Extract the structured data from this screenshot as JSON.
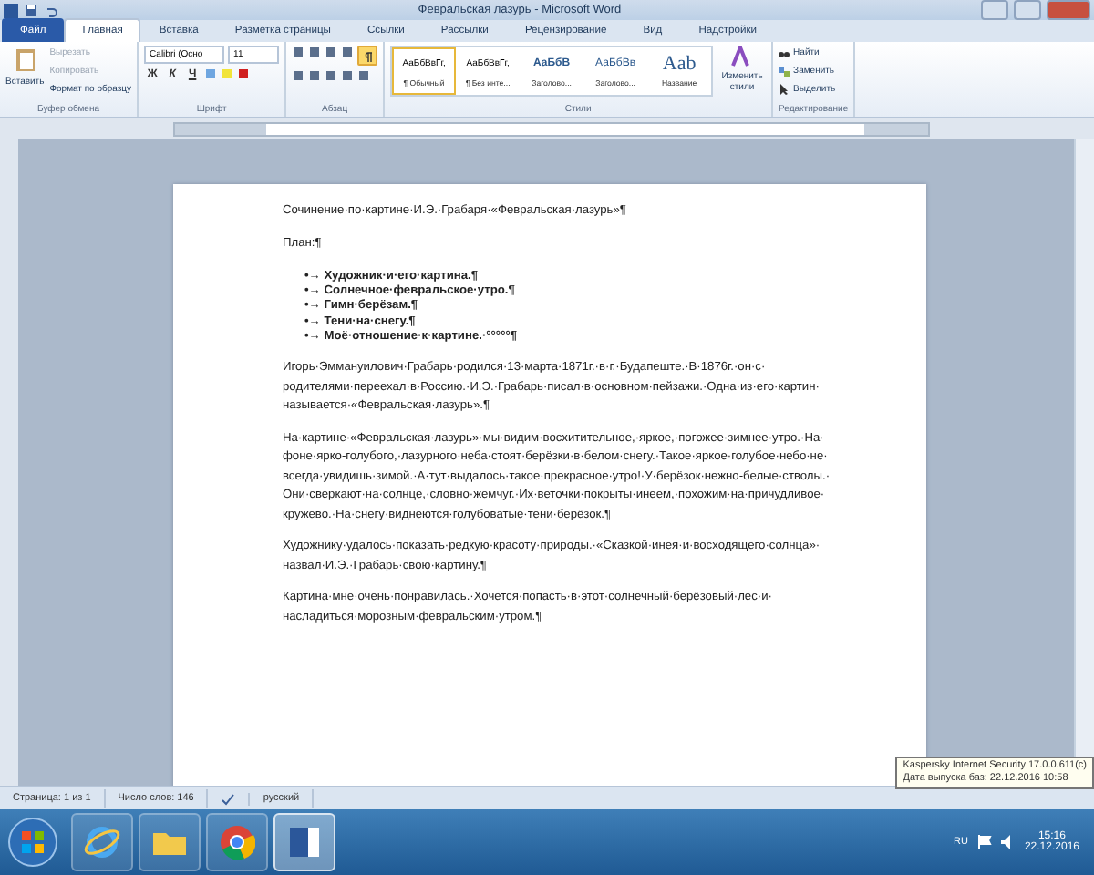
{
  "window": {
    "title": "Февральская лазурь - Microsoft Word"
  },
  "tabs": [
    {
      "label": "Файл",
      "kind": "file",
      "selected": false
    },
    {
      "label": "Главная",
      "kind": "tab",
      "selected": true
    },
    {
      "label": "Вставка",
      "kind": "tab",
      "selected": false
    },
    {
      "label": "Разметка страницы",
      "kind": "tab",
      "selected": false
    },
    {
      "label": "Ссылки",
      "kind": "tab",
      "selected": false
    },
    {
      "label": "Рассылки",
      "kind": "tab",
      "selected": false
    },
    {
      "label": "Рецензирование",
      "kind": "tab",
      "selected": false
    },
    {
      "label": "Вид",
      "kind": "tab",
      "selected": false
    },
    {
      "label": "Надстройки",
      "kind": "tab",
      "selected": false
    }
  ],
  "clipboard": {
    "group": "Буфер обмена",
    "paste": "Вставить",
    "items": [
      {
        "label": "Вырезать",
        "disabled": true
      },
      {
        "label": "Копировать",
        "disabled": true
      },
      {
        "label": "Формат по образцу",
        "disabled": false
      }
    ]
  },
  "font": {
    "group": "Шрифт",
    "name": "Calibri (Осно",
    "size": "11",
    "buttons": [
      "Ж",
      "К",
      "Ч"
    ]
  },
  "paragraph": {
    "group": "Абзац",
    "show_marks": true
  },
  "styles": {
    "group": "Стили",
    "change": "Изменить стили",
    "items": [
      {
        "sample": "АаБбВвГг,",
        "label": "¶ Обычный",
        "kind": "body",
        "selected": true
      },
      {
        "sample": "АаБбВвГг,",
        "label": "¶ Без инте...",
        "kind": "body",
        "selected": false
      },
      {
        "sample": "АаБбВ",
        "label": "Заголово...",
        "kind": "heading",
        "selected": false
      },
      {
        "sample": "АаБбВв",
        "label": "Заголово...",
        "kind": "heading2",
        "selected": false
      },
      {
        "sample": "Aab",
        "label": "Название",
        "kind": "title",
        "selected": false
      }
    ]
  },
  "editing": {
    "group": "Редактирование",
    "items": [
      {
        "label": "Найти",
        "kind": "find"
      },
      {
        "label": "Заменить",
        "kind": "replace"
      },
      {
        "label": "Выделить",
        "kind": "select"
      }
    ]
  },
  "document": {
    "title": "Сочинение·по·картине·И.Э.·Грабаря·«Февральская·лазурь»¶",
    "plan": "План:¶",
    "marker": "•→",
    "list": [
      "Художник·и·его·картина.¶",
      "Солнечное·февральское·утро.¶",
      "Гимн·берёзам.¶",
      "Тени·на·снегу.¶",
      "Моё·отношение·к·картине.·°°°°°¶"
    ],
    "paragraphs": [
      [
        "Игорь·Эммануилович·Грабарь·родился·13·марта·1871г.·в·г.·Будапеште.·В·1876г.·он·с·",
        "родителями·переехал·в·Россию.·И.Э.·Грабарь·писал·в·основном·пейзажи.·Одна·из·его·картин·",
        "называется·«Февральская·лазурь».¶"
      ],
      [
        "На·картине·«Февральская·лазурь»·мы·видим·восхитительное,·яркое,·погожее·зимнее·утро.·На·",
        "фоне·ярко-голубого,·лазурного·неба·стоят·берёзки·в·белом·снегу.·Такое·яркое·голубое·небо·не·",
        "всегда·увидишь·зимой.·А·тут·выдалось·такое·прекрасное·утро!·У·берёзок·нежно-белые·стволы.·",
        "Они·сверкают·на·солнце,·словно·жемчуг.·Их·веточки·покрыты·инеем,·похожим·на·причудливое·",
        "кружево.·На·снегу·виднеются·голубоватые·тени·берёзок.¶"
      ],
      [
        "Художнику·удалось·показать·редкую·красоту·природы.·«Сказкой·инея·и·восходящего·солнца»·",
        "назвал·И.Э.·Грабарь·свою·картину.¶"
      ],
      [
        "Картина·мне·очень·понравилась.·Хочется·попасть·в·этот·солнечный·берёзовый·лес·и·",
        "насладиться·морозным·февральским·утром.¶"
      ]
    ]
  },
  "status_bar": {
    "items": [
      "Страница: 1 из 1",
      "Число слов: 146"
    ],
    "language": "русский"
  },
  "tooltip": {
    "lines": [
      "Kaspersky Internet Security 17.0.0.611(c)",
      "Дата выпуска баз: 22.12.2016 10:58"
    ]
  },
  "taskbar": {
    "apps": [
      {
        "kind": "ie",
        "selected": false
      },
      {
        "kind": "folder",
        "selected": false
      },
      {
        "kind": "chrome",
        "selected": false
      },
      {
        "kind": "word",
        "selected": true
      }
    ],
    "language": "RU",
    "time": "15:16",
    "date": "22.12.2016"
  }
}
